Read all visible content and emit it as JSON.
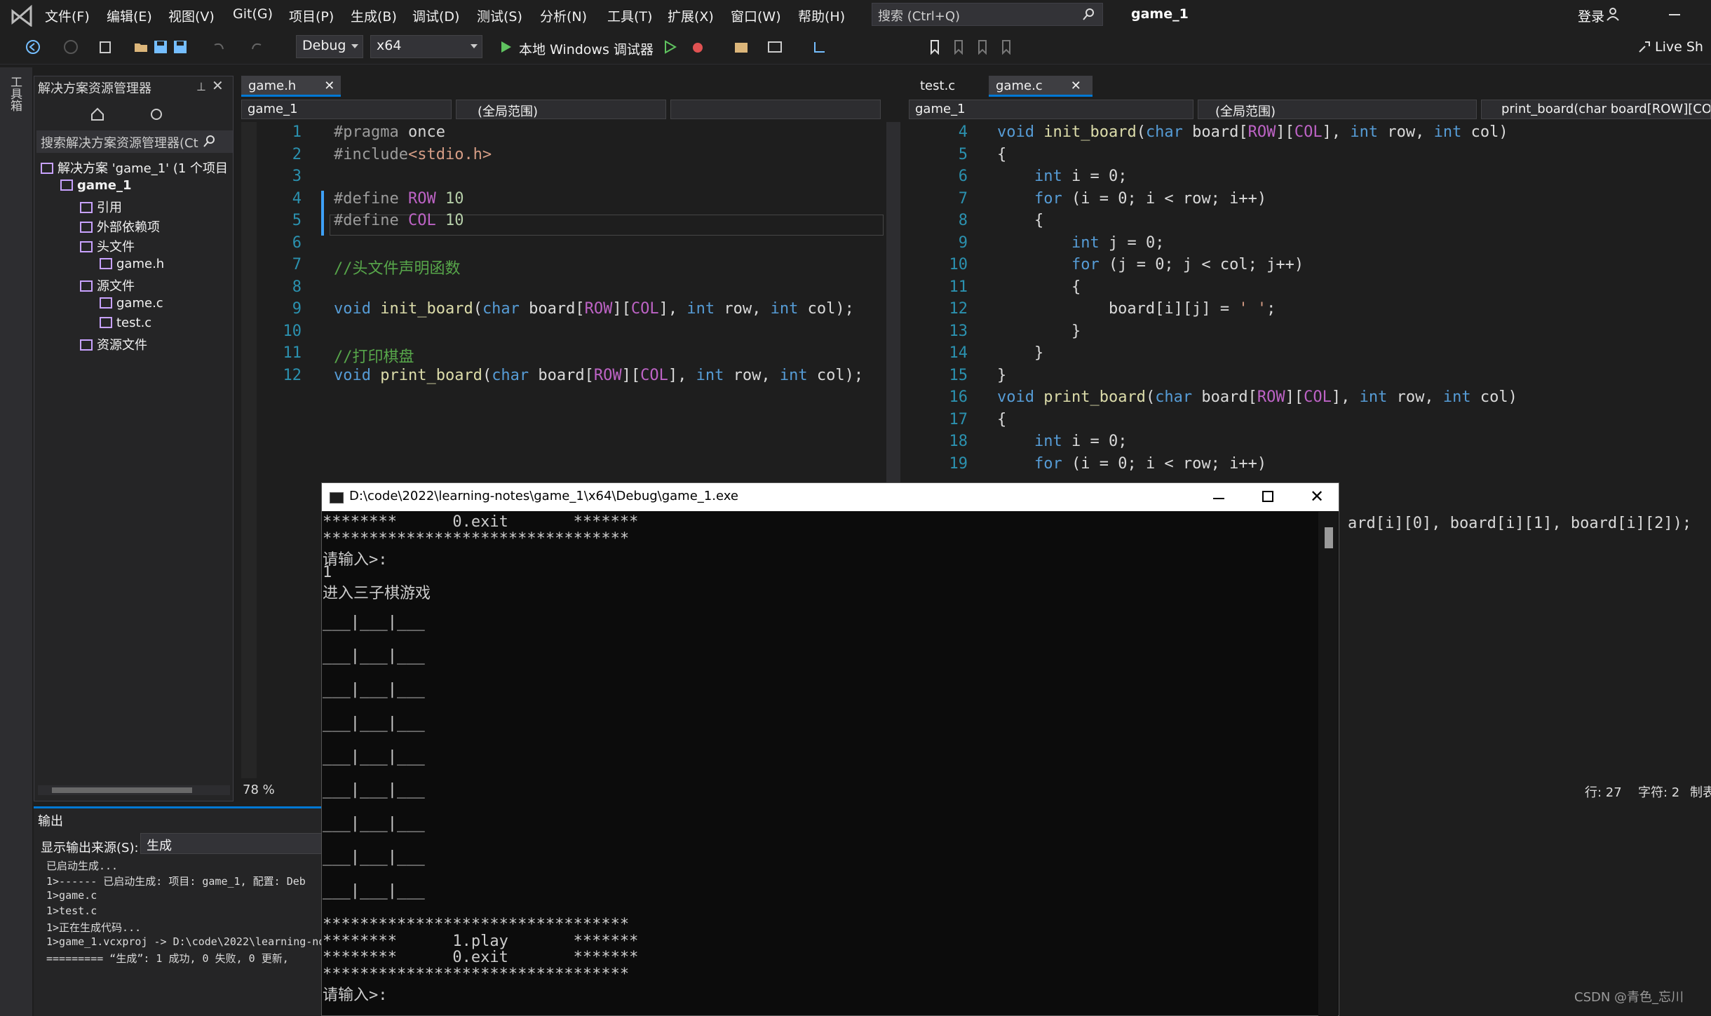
{
  "menubar": {
    "items": [
      "文件(F)",
      "编辑(E)",
      "视图(V)",
      "Git(G)",
      "项目(P)",
      "生成(B)",
      "调试(D)",
      "测试(S)",
      "分析(N)",
      "工具(T)",
      "扩展(X)",
      "窗口(W)",
      "帮助(H)"
    ],
    "search_placeholder": "搜索 (Ctrl+Q)",
    "solution_name": "game_1",
    "login": "登录"
  },
  "toolbar": {
    "config": "Debug",
    "platform": "x64",
    "run_label": "本地 Windows 调试器",
    "liveshare": "Live Sh"
  },
  "toolbox_label": "工具箱",
  "solution_explorer": {
    "title": "解决方案资源管理器",
    "search_placeholder": "搜索解决方案资源管理器(Ct",
    "tree": [
      {
        "label": "解决方案 'game_1' (1 个项目",
        "indent": 0
      },
      {
        "label": "game_1",
        "indent": 1,
        "bold": true
      },
      {
        "label": "引用",
        "indent": 2
      },
      {
        "label": "外部依赖项",
        "indent": 2
      },
      {
        "label": "头文件",
        "indent": 2
      },
      {
        "label": "game.h",
        "indent": 3
      },
      {
        "label": "源文件",
        "indent": 2
      },
      {
        "label": "game.c",
        "indent": 3
      },
      {
        "label": "test.c",
        "indent": 3
      },
      {
        "label": "资源文件",
        "indent": 2
      }
    ]
  },
  "left_editor": {
    "tab": "game.h",
    "nav_project": "game_1",
    "nav_scope": "(全局范围)",
    "zoom": "78 %",
    "line_numbers": [
      "1",
      "2",
      "3",
      "4",
      "5",
      "6",
      "7",
      "8",
      "9",
      "10",
      "11",
      "12"
    ],
    "lines": [
      "#pragma once",
      "#include<stdio.h>",
      "",
      "#define ROW 10",
      "#define COL 10",
      "",
      "//头文件声明函数",
      "",
      "void init_board(char board[ROW][COL], int row, int col);",
      "",
      "//打印棋盘",
      "void print_board(char board[ROW][COL], int row, int col);"
    ]
  },
  "right_editor": {
    "tabs": [
      "test.c",
      "game.c"
    ],
    "nav_project": "game_1",
    "nav_scope": "(全局范围)",
    "nav_member": "print_board(char board[ROW][CO",
    "line_numbers": [
      "4",
      "5",
      "6",
      "7",
      "8",
      "9",
      "10",
      "11",
      "12",
      "13",
      "14",
      "15",
      "16",
      "17",
      "18",
      "19"
    ],
    "lines": [
      "void init_board(char board[ROW][COL], int row, int col)",
      "{",
      "    int i = 0;",
      "    for (i = 0; i < row; i++)",
      "    {",
      "        int j = 0;",
      "        for (j = 0; j < col; j++)",
      "        {",
      "            board[i][j] = ' ';",
      "        }",
      "    }",
      "}",
      "void print_board(char board[ROW][COL], int row, int col)",
      "{",
      "    int i = 0;",
      "    for (i = 0; i < row; i++)"
    ],
    "partial_line": "ard[i][0], board[i][1], board[i][2]);",
    "status_line": "行: 27",
    "status_col": "字符: 2",
    "status_extra": "制表"
  },
  "output": {
    "title": "输出",
    "source_label": "显示输出来源(S):",
    "source_value": "生成",
    "lines": [
      "已启动生成...",
      "1>------ 已启动生成: 项目: game_1, 配置: Deb",
      "1>game.c",
      "1>test.c",
      "1>正在生成代码...",
      "1>game_1.vcxproj -> D:\\code\\2022\\learning-no",
      "========= “生成”: 1 成功, 0 失败, 0 更新,"
    ]
  },
  "console": {
    "title": "D:\\code\\2022\\learning-notes\\game_1\\x64\\Debug\\game_1.exe",
    "lines": [
      "********      0.exit       *******",
      "*********************************",
      "请输入>:",
      "1",
      "进入三子棋游戏",
      "",
      "___|___|___",
      "",
      "___|___|___",
      "",
      "___|___|___",
      "",
      "___|___|___",
      "",
      "___|___|___",
      "",
      "___|___|___",
      "",
      "___|___|___",
      "",
      "___|___|___",
      "",
      "___|___|___",
      "",
      "*********************************",
      "********      1.play       *******",
      "********      0.exit       *******",
      "*********************************",
      "请输入>:"
    ]
  },
  "watermark": "CSDN @青色_忘川"
}
